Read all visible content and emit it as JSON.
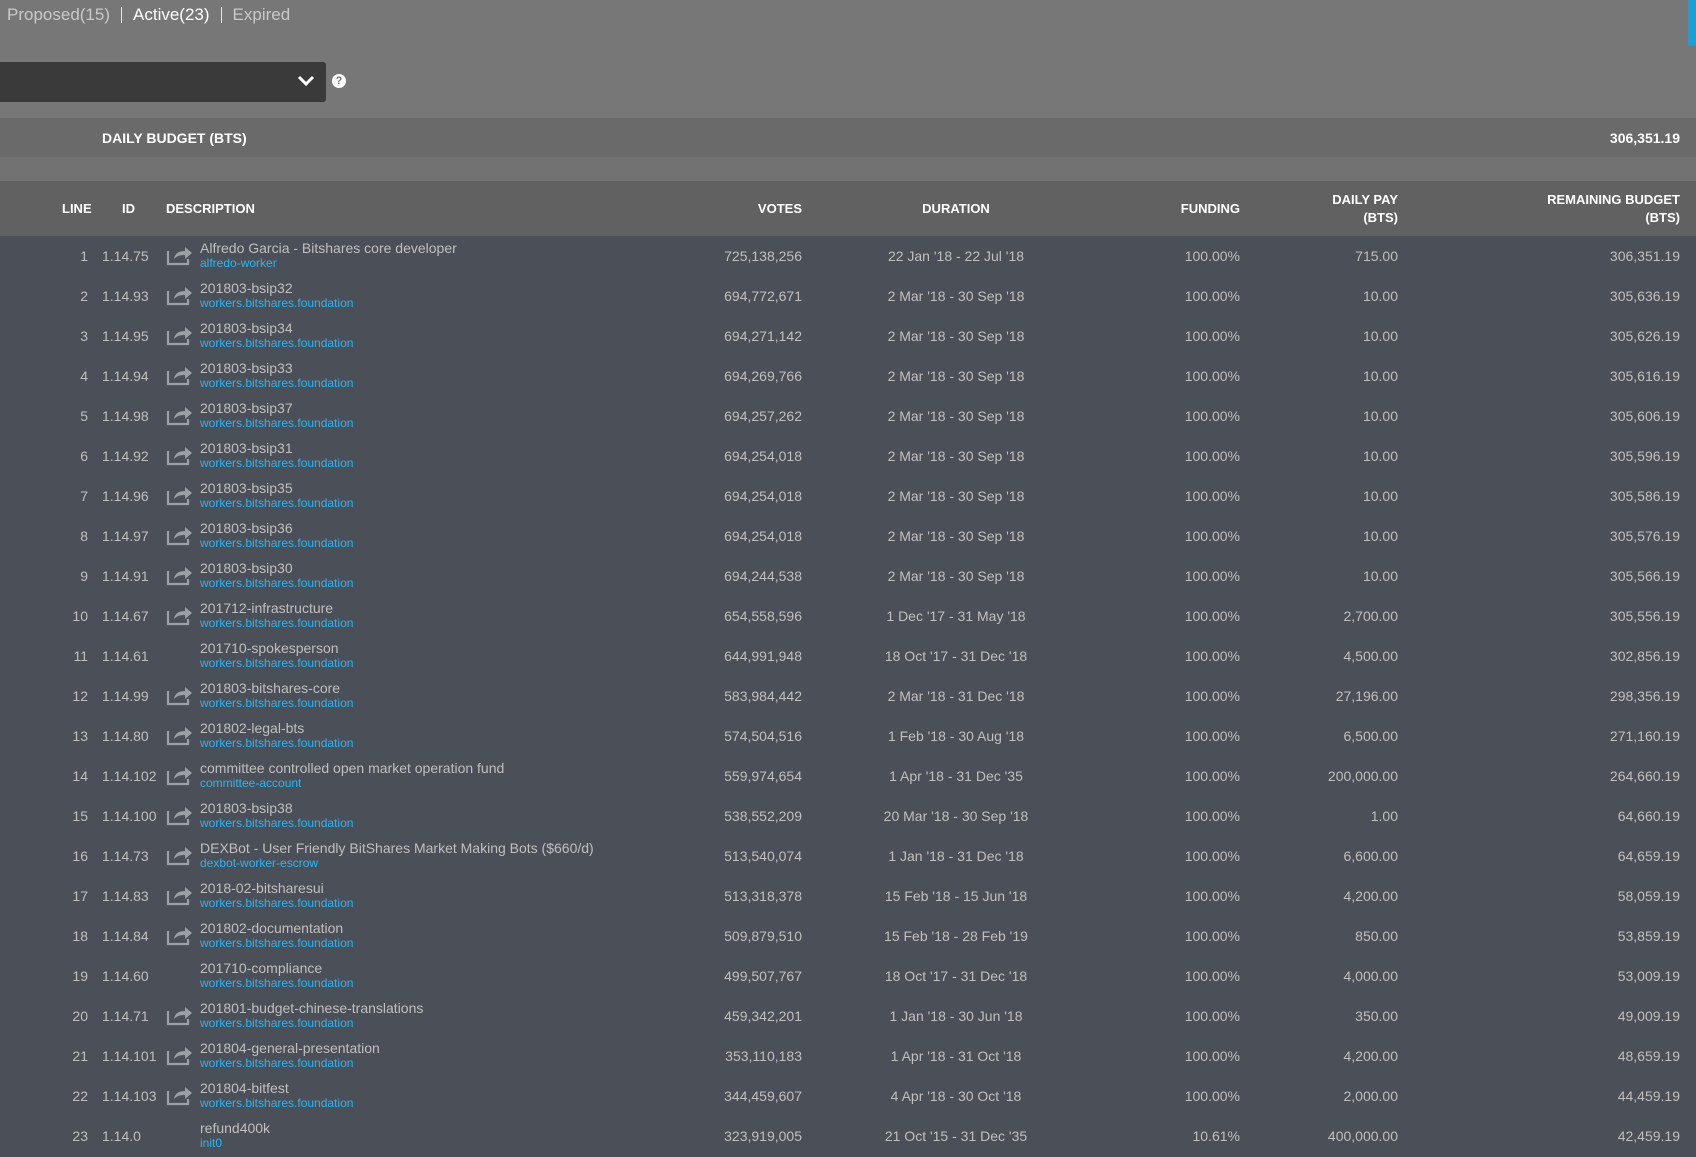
{
  "tabs": [
    {
      "label": "Proposed(15)",
      "active": false
    },
    {
      "label": "Active(23)",
      "active": true
    },
    {
      "label": "Expired",
      "active": false
    }
  ],
  "filter": {
    "value": ""
  },
  "budget": {
    "label": "DAILY BUDGET (BTS)",
    "value": "306,351.19"
  },
  "columns": {
    "line": "LINE",
    "id": "ID",
    "description": "DESCRIPTION",
    "votes": "VOTES",
    "duration": "DURATION",
    "funding": "FUNDING",
    "daily_pay": "DAILY PAY",
    "daily_pay_unit": "(BTS)",
    "remaining": "REMAINING BUDGET",
    "remaining_unit": "(BTS)"
  },
  "rows": [
    {
      "line": "1",
      "id": "1.14.75",
      "icon": true,
      "title": "Alfredo Garcia - Bitshares core developer",
      "owner": "alfredo-worker",
      "votes": "725,138,256",
      "duration": "22 Jan '18 - 22 Jul '18",
      "funding": "100.00%",
      "daily_pay": "715.00",
      "remaining": "306,351.19"
    },
    {
      "line": "2",
      "id": "1.14.93",
      "icon": true,
      "title": "201803-bsip32",
      "owner": "workers.bitshares.foundation",
      "votes": "694,772,671",
      "duration": "2 Mar '18 - 30 Sep '18",
      "funding": "100.00%",
      "daily_pay": "10.00",
      "remaining": "305,636.19"
    },
    {
      "line": "3",
      "id": "1.14.95",
      "icon": true,
      "title": "201803-bsip34",
      "owner": "workers.bitshares.foundation",
      "votes": "694,271,142",
      "duration": "2 Mar '18 - 30 Sep '18",
      "funding": "100.00%",
      "daily_pay": "10.00",
      "remaining": "305,626.19"
    },
    {
      "line": "4",
      "id": "1.14.94",
      "icon": true,
      "title": "201803-bsip33",
      "owner": "workers.bitshares.foundation",
      "votes": "694,269,766",
      "duration": "2 Mar '18 - 30 Sep '18",
      "funding": "100.00%",
      "daily_pay": "10.00",
      "remaining": "305,616.19"
    },
    {
      "line": "5",
      "id": "1.14.98",
      "icon": true,
      "title": "201803-bsip37",
      "owner": "workers.bitshares.foundation",
      "votes": "694,257,262",
      "duration": "2 Mar '18 - 30 Sep '18",
      "funding": "100.00%",
      "daily_pay": "10.00",
      "remaining": "305,606.19"
    },
    {
      "line": "6",
      "id": "1.14.92",
      "icon": true,
      "title": "201803-bsip31",
      "owner": "workers.bitshares.foundation",
      "votes": "694,254,018",
      "duration": "2 Mar '18 - 30 Sep '18",
      "funding": "100.00%",
      "daily_pay": "10.00",
      "remaining": "305,596.19"
    },
    {
      "line": "7",
      "id": "1.14.96",
      "icon": true,
      "title": "201803-bsip35",
      "owner": "workers.bitshares.foundation",
      "votes": "694,254,018",
      "duration": "2 Mar '18 - 30 Sep '18",
      "funding": "100.00%",
      "daily_pay": "10.00",
      "remaining": "305,586.19"
    },
    {
      "line": "8",
      "id": "1.14.97",
      "icon": true,
      "title": "201803-bsip36",
      "owner": "workers.bitshares.foundation",
      "votes": "694,254,018",
      "duration": "2 Mar '18 - 30 Sep '18",
      "funding": "100.00%",
      "daily_pay": "10.00",
      "remaining": "305,576.19"
    },
    {
      "line": "9",
      "id": "1.14.91",
      "icon": true,
      "title": "201803-bsip30",
      "owner": "workers.bitshares.foundation",
      "votes": "694,244,538",
      "duration": "2 Mar '18 - 30 Sep '18",
      "funding": "100.00%",
      "daily_pay": "10.00",
      "remaining": "305,566.19"
    },
    {
      "line": "10",
      "id": "1.14.67",
      "icon": true,
      "title": "201712-infrastructure",
      "owner": "workers.bitshares.foundation",
      "votes": "654,558,596",
      "duration": "1 Dec '17 - 31 May '18",
      "funding": "100.00%",
      "daily_pay": "2,700.00",
      "remaining": "305,556.19"
    },
    {
      "line": "11",
      "id": "1.14.61",
      "icon": false,
      "title": "201710-spokesperson",
      "owner": "workers.bitshares.foundation",
      "votes": "644,991,948",
      "duration": "18 Oct '17 - 31 Dec '18",
      "funding": "100.00%",
      "daily_pay": "4,500.00",
      "remaining": "302,856.19"
    },
    {
      "line": "12",
      "id": "1.14.99",
      "icon": true,
      "title": "201803-bitshares-core",
      "owner": "workers.bitshares.foundation",
      "votes": "583,984,442",
      "duration": "2 Mar '18 - 31 Dec '18",
      "funding": "100.00%",
      "daily_pay": "27,196.00",
      "remaining": "298,356.19"
    },
    {
      "line": "13",
      "id": "1.14.80",
      "icon": true,
      "title": "201802-legal-bts",
      "owner": "workers.bitshares.foundation",
      "votes": "574,504,516",
      "duration": "1 Feb '18 - 30 Aug '18",
      "funding": "100.00%",
      "daily_pay": "6,500.00",
      "remaining": "271,160.19"
    },
    {
      "line": "14",
      "id": "1.14.102",
      "icon": true,
      "title": "committee controlled open market operation fund",
      "owner": "committee-account",
      "votes": "559,974,654",
      "duration": "1 Apr '18 - 31 Dec '35",
      "funding": "100.00%",
      "daily_pay": "200,000.00",
      "remaining": "264,660.19"
    },
    {
      "line": "15",
      "id": "1.14.100",
      "icon": true,
      "title": "201803-bsip38",
      "owner": "workers.bitshares.foundation",
      "votes": "538,552,209",
      "duration": "20 Mar '18 - 30 Sep '18",
      "funding": "100.00%",
      "daily_pay": "1.00",
      "remaining": "64,660.19"
    },
    {
      "line": "16",
      "id": "1.14.73",
      "icon": true,
      "title": "DEXBot - User Friendly BitShares Market Making Bots ($660/d)",
      "owner": "dexbot-worker-escrow",
      "votes": "513,540,074",
      "duration": "1 Jan '18 - 31 Dec '18",
      "funding": "100.00%",
      "daily_pay": "6,600.00",
      "remaining": "64,659.19"
    },
    {
      "line": "17",
      "id": "1.14.83",
      "icon": true,
      "title": "2018-02-bitsharesui",
      "owner": "workers.bitshares.foundation",
      "votes": "513,318,378",
      "duration": "15 Feb '18 - 15 Jun '18",
      "funding": "100.00%",
      "daily_pay": "4,200.00",
      "remaining": "58,059.19"
    },
    {
      "line": "18",
      "id": "1.14.84",
      "icon": true,
      "title": "201802-documentation",
      "owner": "workers.bitshares.foundation",
      "votes": "509,879,510",
      "duration": "15 Feb '18 - 28 Feb '19",
      "funding": "100.00%",
      "daily_pay": "850.00",
      "remaining": "53,859.19"
    },
    {
      "line": "19",
      "id": "1.14.60",
      "icon": false,
      "title": "201710-compliance",
      "owner": "workers.bitshares.foundation",
      "votes": "499,507,767",
      "duration": "18 Oct '17 - 31 Dec '18",
      "funding": "100.00%",
      "daily_pay": "4,000.00",
      "remaining": "53,009.19"
    },
    {
      "line": "20",
      "id": "1.14.71",
      "icon": true,
      "title": "201801-budget-chinese-translations",
      "owner": "workers.bitshares.foundation",
      "votes": "459,342,201",
      "duration": "1 Jan '18 - 30 Jun '18",
      "funding": "100.00%",
      "daily_pay": "350.00",
      "remaining": "49,009.19"
    },
    {
      "line": "21",
      "id": "1.14.101",
      "icon": true,
      "title": "201804-general-presentation",
      "owner": "workers.bitshares.foundation",
      "votes": "353,110,183",
      "duration": "1 Apr '18 - 31 Oct '18",
      "funding": "100.00%",
      "daily_pay": "4,200.00",
      "remaining": "48,659.19"
    },
    {
      "line": "22",
      "id": "1.14.103",
      "icon": true,
      "title": "201804-bitfest",
      "owner": "workers.bitshares.foundation",
      "votes": "344,459,607",
      "duration": "4 Apr '18 - 30 Oct '18",
      "funding": "100.00%",
      "daily_pay": "2,000.00",
      "remaining": "44,459.19"
    },
    {
      "line": "23",
      "id": "1.14.0",
      "icon": false,
      "title": "refund400k",
      "owner": "init0",
      "votes": "323,919,005",
      "duration": "21 Oct '15 - 31 Dec '35",
      "funding": "10.61%",
      "daily_pay": "400,000.00",
      "remaining": "42,459.19"
    }
  ],
  "colors": {
    "accent": "#1a9fd9",
    "link": "#29b6f6",
    "top_bg": "#777777",
    "table_bg": "#4b5058"
  }
}
